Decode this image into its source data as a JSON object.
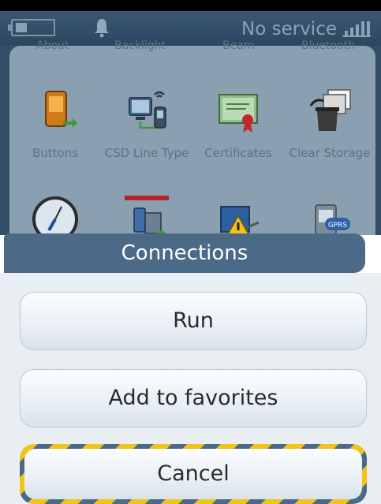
{
  "status_bar": {
    "service_text": "No service",
    "icons": [
      "battery-icon",
      "bell-icon",
      "signal-icon"
    ]
  },
  "background_grid": {
    "cut_labels": [
      "About",
      "Backlight",
      "Beam",
      "Bluetooth"
    ],
    "apps": [
      {
        "label": "Buttons",
        "icon": "buttons-icon"
      },
      {
        "label": "CSD Line Type",
        "icon": "csd-line-type-icon"
      },
      {
        "label": "Certificates",
        "icon": "certificates-icon"
      },
      {
        "label": "Clear Storage",
        "icon": "clear-storage-icon"
      },
      {
        "label": "",
        "icon": "clock-icon"
      },
      {
        "label": "",
        "icon": "network-icon"
      },
      {
        "label": "",
        "icon": "warning-icon"
      },
      {
        "label": "",
        "icon": "gprs-icon"
      }
    ]
  },
  "sheet": {
    "title": "Connections",
    "buttons": {
      "run": "Run",
      "add_to_favorites": "Add to favorites",
      "cancel": "Cancel"
    }
  },
  "colors": {
    "status_bar": "#3b5873",
    "header": "#4b6a88",
    "highlight_yellow": "#f2c318",
    "sheet_background": "#e9eef3"
  }
}
